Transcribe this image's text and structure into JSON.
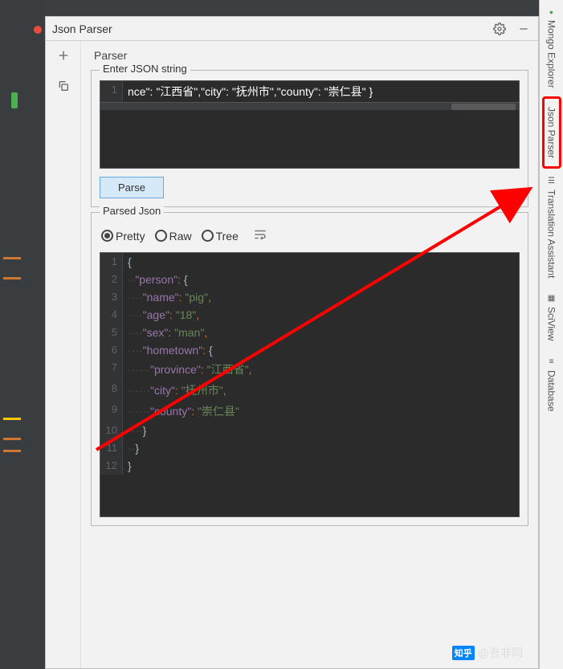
{
  "panel": {
    "title": "Json Parser",
    "sub_title": "Parser"
  },
  "input": {
    "legend": "Enter JSON string",
    "line_num": "1",
    "content": "nce\": \"江西省\",\"city\": \"抚州市\",\"county\": \"崇仁县\" }",
    "parse_button": "Parse"
  },
  "output": {
    "legend": "Parsed Json",
    "view_modes": {
      "pretty": "Pretty",
      "raw": "Raw",
      "tree": "Tree"
    },
    "lines": [
      {
        "n": "1",
        "html": "<span class='tok-brace'>{</span>"
      },
      {
        "n": "2",
        "html": "<span class='indent-guide'>··</span><span class='tok-key'>\"person\"</span><span class='tok-punc'>: </span><span class='tok-brace'>{</span>"
      },
      {
        "n": "3",
        "html": "<span class='indent-guide'>····</span><span class='tok-key'>\"name\"</span><span class='tok-punc'>: </span><span class='tok-str'>\"pig\"</span><span class='tok-punc'>,</span>"
      },
      {
        "n": "4",
        "html": "<span class='indent-guide'>····</span><span class='tok-key'>\"age\"</span><span class='tok-punc'>: </span><span class='tok-str'>\"18\"</span><span class='tok-punc'>,</span>"
      },
      {
        "n": "5",
        "html": "<span class='indent-guide'>····</span><span class='tok-key'>\"sex\"</span><span class='tok-punc'>: </span><span class='tok-str'>\"man\"</span><span class='tok-punc'>,</span>"
      },
      {
        "n": "6",
        "html": "<span class='indent-guide'>····</span><span class='tok-key'>\"hometown\"</span><span class='tok-punc'>: </span><span class='tok-brace'>{</span>"
      },
      {
        "n": "7",
        "html": "<span class='indent-guide'>······</span><span class='tok-key'>\"province\"</span><span class='tok-punc'>: </span><span class='tok-str'>\"江西省\"</span><span class='tok-punc'>,</span>"
      },
      {
        "n": "8",
        "html": "<span class='indent-guide'>······</span><span class='tok-key'>\"city\"</span><span class='tok-punc'>: </span><span class='tok-str'>\"抚州市\"</span><span class='tok-punc'>,</span>"
      },
      {
        "n": "9",
        "html": "<span class='indent-guide'>······</span><span class='tok-key'>\"county\"</span><span class='tok-punc'>: </span><span class='tok-str'>\"崇仁县\"</span>"
      },
      {
        "n": "10",
        "html": "<span class='indent-guide'>····</span><span class='tok-brace'>}</span>"
      },
      {
        "n": "11",
        "html": "<span class='indent-guide'>··</span><span class='tok-brace'>}</span>"
      },
      {
        "n": "12",
        "html": "<span class='tok-brace'>}</span>"
      }
    ]
  },
  "rail": {
    "mongo": "Mongo Explorer",
    "json_parser": "Json Parser",
    "translation": "Translation Assistant",
    "sciview": "SciView",
    "database": "Database"
  },
  "watermark": {
    "logo": "知乎",
    "text": "@吾非同"
  }
}
